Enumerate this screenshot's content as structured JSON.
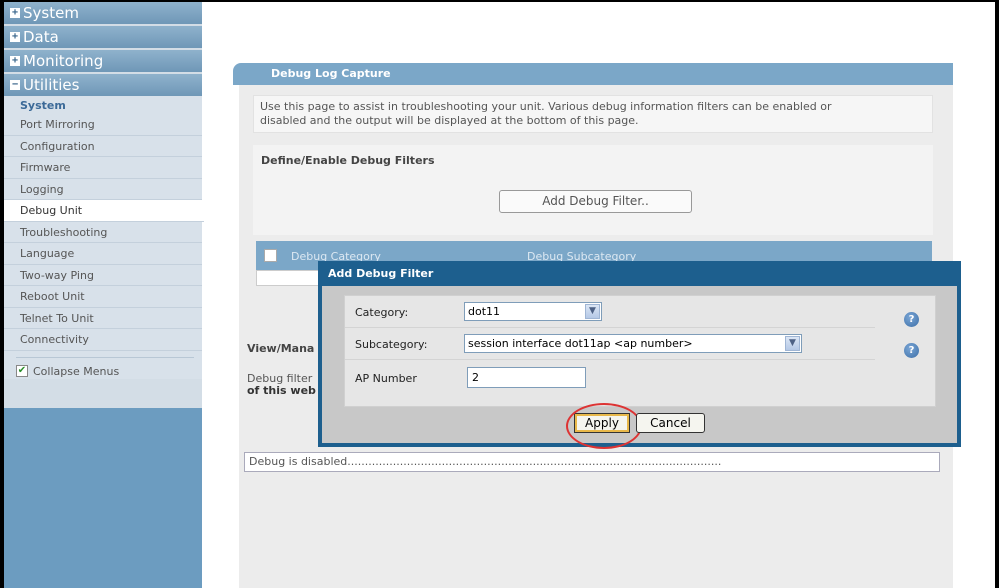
{
  "sidebar": {
    "sections": [
      {
        "label": "System",
        "toggle": "+"
      },
      {
        "label": "Data",
        "toggle": "+"
      },
      {
        "label": "Monitoring",
        "toggle": "+"
      }
    ],
    "utilities": {
      "label": "Utilities",
      "toggle": "−",
      "subsection": "System",
      "items": [
        "Port Mirroring",
        "Configuration",
        "Firmware",
        "Logging",
        "Debug Unit",
        "Troubleshooting",
        "Language",
        "Two-way Ping",
        "Reboot Unit",
        "Telnet To Unit",
        "Connectivity"
      ],
      "active_item": "Debug Unit"
    },
    "collapse_menus": {
      "label": "Collapse Menus",
      "checked": true
    }
  },
  "main": {
    "panel_title": "Debug Log Capture",
    "intro_line1": "Use this page to assist in troubleshooting your unit. Various debug information filters can be enabled or",
    "intro_line2": "disabled and the output will be displayed at the bottom of this page.",
    "define_section_title": "Define/Enable Debug Filters",
    "add_filter_button": "Add Debug Filter..",
    "table_headers": [
      "Debug Category",
      "Debug Subcategory"
    ],
    "view_manage_label": "View/Mana",
    "debug_filter_line1": "Debug filter",
    "debug_filter_line2": "of this web",
    "debug_output": "Debug is disabled..........................................................................................................."
  },
  "dialog": {
    "title": "Add Debug Filter",
    "category_label": "Category:",
    "category_value": "dot11",
    "subcategory_label": "Subcategory:",
    "subcategory_value": "session interface dot11ap <ap number>",
    "ap_number_label": "AP Number",
    "ap_number_value": "2",
    "apply_button": "Apply",
    "cancel_button": "Cancel",
    "help_glyph": "?",
    "dropdown_glyph": "▼"
  },
  "colors": {
    "panel_header": "#7ba7c8",
    "dialog_border": "#1d5f8e",
    "highlight_circle": "#dd3333"
  }
}
